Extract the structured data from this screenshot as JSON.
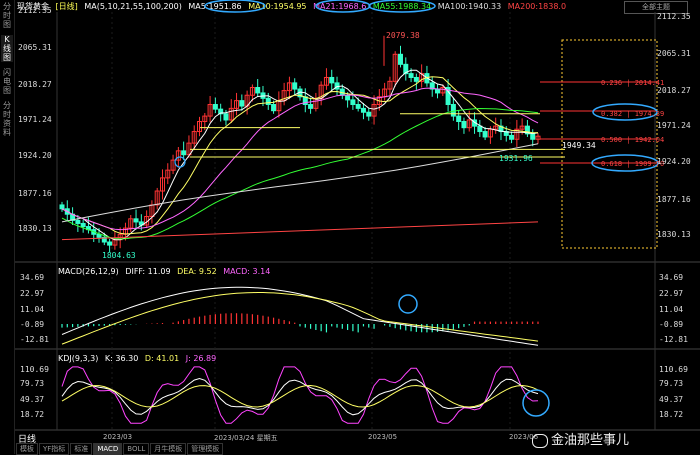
{
  "sidebar": {
    "tabs": [
      "分时图",
      "K线图",
      "闪电图",
      "分时资料"
    ]
  },
  "header": {
    "instrument": "现货黄金",
    "period_tag": "[日线]",
    "ma_params": "MA(5,10,21,55,100,200)",
    "ma5": "MA5:1951.86",
    "ma10": "MA10:1954.95",
    "ma21": "MA21:1968.6",
    "ma55": "MA55:1988.34",
    "ma100": "MA100:1940.33",
    "ma200": "MA200:1838.0",
    "right_button": "全部主题"
  },
  "main_axis": {
    "left": [
      "2112.35",
      "2065.31",
      "2018.27",
      "1971.24",
      "1924.20",
      "1877.16",
      "1830.13"
    ],
    "right": [
      "2112.35",
      "2065.31",
      "2018.27",
      "1971.24",
      "1924.20",
      "1877.16",
      "1830.13"
    ]
  },
  "annotations": {
    "peak": "2079.38",
    "low": "1804.63",
    "support": "1931.96",
    "current": "1949.34",
    "fib_0236": "0.236 | 2014.41",
    "fib_0382": "0.382 | 1974.39",
    "fib_0500": "0.500 | 1942.04",
    "fib_0618": "0.618 | 1909.70"
  },
  "macd": {
    "header": "MACD(26,12,9)",
    "diff": "DIFF: 11.09",
    "dea": "DEA: 9.52",
    "macd": "MACD: 3.14",
    "axis": [
      "34.69",
      "22.97",
      "11.04",
      "-0.89",
      "-12.81"
    ]
  },
  "kdj": {
    "header": "KDJ(9,3,3)",
    "k": "K: 36.30",
    "d": "D: 41.01",
    "j": "J: 26.89",
    "axis": [
      "110.69",
      "79.73",
      "49.37",
      "18.72"
    ]
  },
  "footer": {
    "period": "日线",
    "dates": [
      "2023/03",
      "2023/03/24 星期五",
      "2023/05",
      "2023/06"
    ],
    "tabs": [
      "模板",
      "YF指标",
      "标准",
      "MACD",
      "BOLL",
      "月牛模板",
      "管理模板"
    ],
    "selected_tab": 3
  },
  "watermark": "金油那些事儿",
  "colors": {
    "up": "#ff3333",
    "down": "#33ffcc",
    "ma5": "#ffffff",
    "ma10": "#ffff66",
    "ma21": "#ff66ff",
    "ma55": "#33ff33",
    "ma100": "#dddddd",
    "ma200": "#ff4444",
    "fib": "#ff3333",
    "highlight": "#33aaff"
  }
}
